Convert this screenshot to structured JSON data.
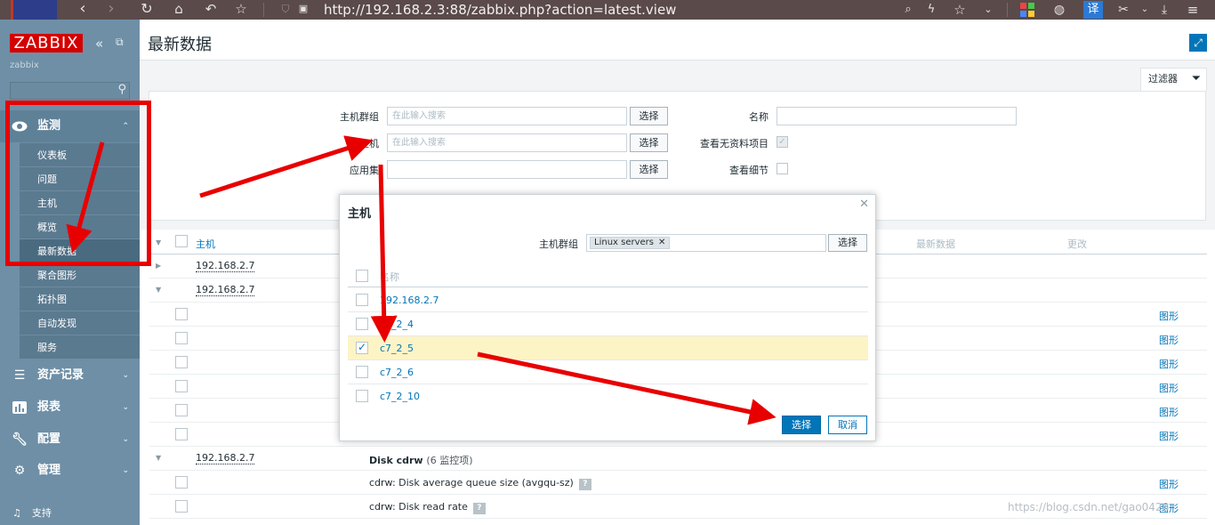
{
  "browser": {
    "url": "http://192.168.2.3:88/zabbix.php?action=latest.view",
    "translate_label": "译"
  },
  "sidebar": {
    "logo": "ZABBIX",
    "server_name": "zabbix",
    "sections": [
      {
        "label": "监测",
        "icon": "eye-icon",
        "expanded": true
      },
      {
        "label": "资产记录",
        "icon": "list-icon"
      },
      {
        "label": "报表",
        "icon": "bar-chart-icon"
      },
      {
        "label": "配置",
        "icon": "wrench-icon"
      },
      {
        "label": "管理",
        "icon": "gear-icon"
      }
    ],
    "monitoring_items": [
      "仪表板",
      "问题",
      "主机",
      "概览",
      "最新数据",
      "聚合图形",
      "拓扑图",
      "自动发现",
      "服务"
    ],
    "active_item": "最新数据",
    "support": "支持"
  },
  "page": {
    "title": "最新数据",
    "filter_tab": "过滤器"
  },
  "filter": {
    "host_group_label": "主机群组",
    "host_label": "主机",
    "application_label": "应用集",
    "placeholder": "在此输入搜索",
    "select_button": "选择",
    "name_label": "名称",
    "show_no_data_label": "查看无资料项目",
    "show_details_label": "查看细节"
  },
  "table": {
    "columns": {
      "host": "主机",
      "last_data": "最新数据",
      "change": "更改"
    },
    "hosts": [
      "192.168.2.7",
      "192.168.2.7",
      "192.168.2.7"
    ],
    "app_group": {
      "name": "Disk cdrw",
      "count": "(6 监控项)"
    },
    "items": [
      "cdrw: Disk average queue size (avgqu-sz)",
      "cdrw: Disk read rate"
    ],
    "graph_link": "图形"
  },
  "dialog": {
    "title": "主机",
    "host_group_label": "主机群组",
    "selected_group": "Linux servers",
    "select_button": "选择",
    "name_header": "名称",
    "hosts": [
      {
        "name": "192.168.2.7",
        "checked": false
      },
      {
        "name": "c7_2_4",
        "checked": false
      },
      {
        "name": "c7_2_5",
        "checked": true
      },
      {
        "name": "c7_2_6",
        "checked": false
      },
      {
        "name": "c7_2_10",
        "checked": false
      }
    ],
    "ok_button": "选择",
    "cancel_button": "取消"
  },
  "watermark": "https://blog.csdn.net/gao0428",
  "colors": {
    "sidebar": "#6e8fa6",
    "logo": "#d40000",
    "accent": "#0275b8",
    "annotation": "#e80000",
    "selected_row": "#fdf4c6"
  }
}
